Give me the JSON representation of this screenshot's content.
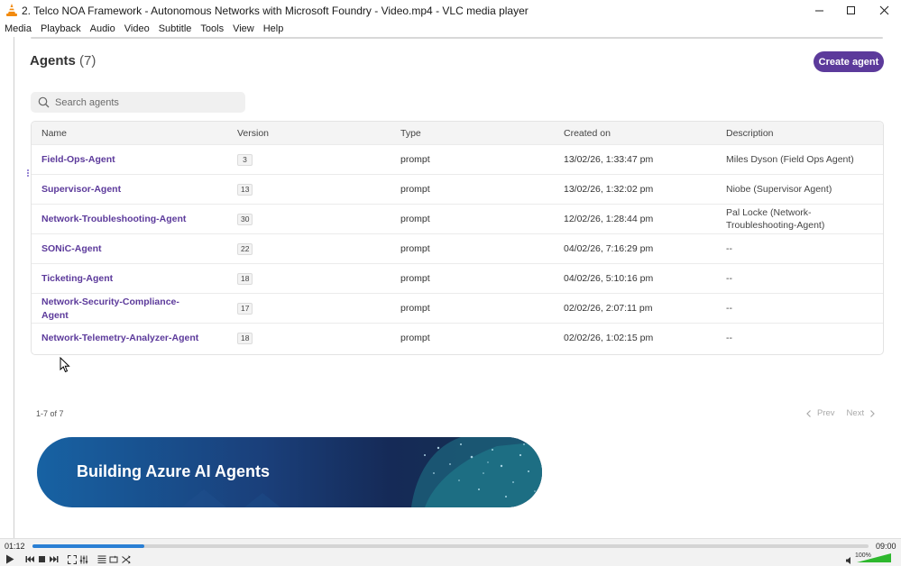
{
  "window": {
    "title": "2. Telco NOA Framework - Autonomous Networks with Microsoft Foundry - Video.mp4 - VLC media player"
  },
  "menu": [
    "Media",
    "Playback",
    "Audio",
    "Video",
    "Subtitle",
    "Tools",
    "View",
    "Help"
  ],
  "page": {
    "heading": "Agents",
    "count": "(7)",
    "create_label": "Create agent",
    "search_placeholder": "Search agents"
  },
  "table": {
    "columns": [
      "Name",
      "Version",
      "Type",
      "Created on",
      "Description"
    ],
    "rows": [
      {
        "name": "Field-Ops-Agent",
        "version": "3",
        "type": "prompt",
        "created": "13/02/26, 1:33:47 pm",
        "description": "Miles Dyson (Field Ops Agent)"
      },
      {
        "name": "Supervisor-Agent",
        "version": "13",
        "type": "prompt",
        "created": "13/02/26, 1:32:02 pm",
        "description": "Niobe (Supervisor Agent)"
      },
      {
        "name": "Network-Troubleshooting-Agent",
        "version": "30",
        "type": "prompt",
        "created": "12/02/26, 1:28:44 pm",
        "description": "Pal Locke (Network-Troubleshooting-Agent)"
      },
      {
        "name": "SONiC-Agent",
        "version": "22",
        "type": "prompt",
        "created": "04/02/26, 7:16:29 pm",
        "description": "--"
      },
      {
        "name": "Ticketing-Agent",
        "version": "18",
        "type": "prompt",
        "created": "04/02/26, 5:10:16 pm",
        "description": "--"
      },
      {
        "name": "Network-Security-Compliance-Agent",
        "version": "17",
        "type": "prompt",
        "created": "02/02/26, 2:07:11 pm",
        "description": "--"
      },
      {
        "name": "Network-Telemetry-Analyzer-Agent",
        "version": "18",
        "type": "prompt",
        "created": "02/02/26, 1:02:15 pm",
        "description": "--"
      }
    ]
  },
  "pagination": {
    "range": "1-7 of 7",
    "prev": "Prev",
    "next": "Next"
  },
  "banner": {
    "text": "Building Azure AI Agents"
  },
  "player": {
    "current_time": "01:12",
    "total_time": "09:00",
    "progress_fraction": 0.134,
    "volume": "100%",
    "accent": "#2a7fd4"
  }
}
